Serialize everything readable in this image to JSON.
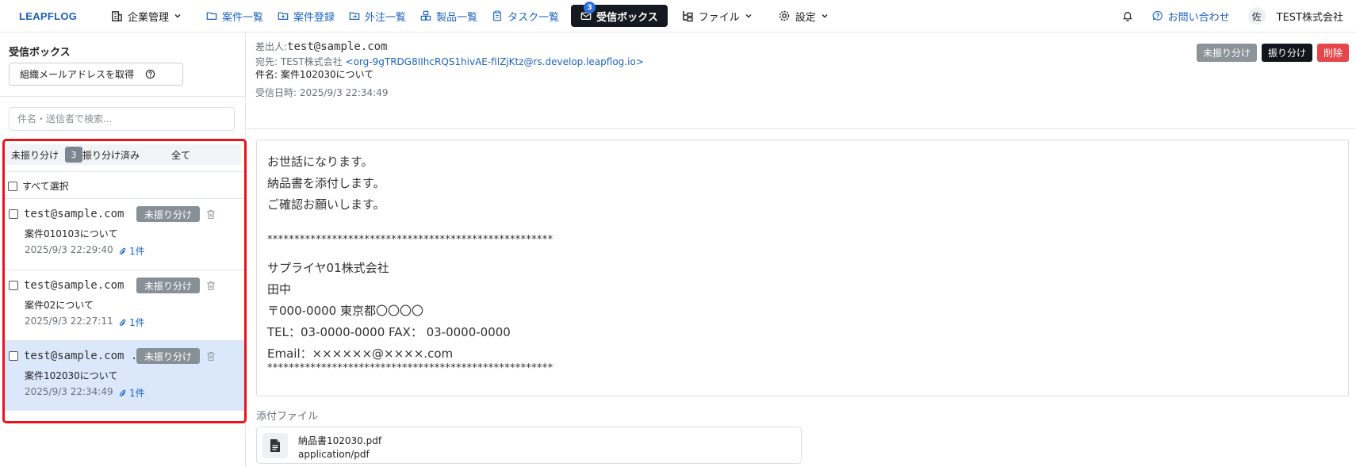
{
  "nav": {
    "logo": "LEAPFLOG",
    "items": [
      {
        "label": "企業管理",
        "icon": "building-icon",
        "style": "dark",
        "caret": true
      },
      {
        "label": "案件一覧",
        "icon": "folder-icon",
        "style": "blue"
      },
      {
        "label": "案件登録",
        "icon": "folder-plus-icon",
        "style": "blue"
      },
      {
        "label": "外注一覧",
        "icon": "folder-out-icon",
        "style": "blue"
      },
      {
        "label": "製品一覧",
        "icon": "boxes-icon",
        "style": "blue"
      },
      {
        "label": "タスク一覧",
        "icon": "clipboard-icon",
        "style": "blue"
      }
    ],
    "inbox": {
      "label": "受信ボックス",
      "badge": "3",
      "icon": "mail-icon"
    },
    "files": {
      "label": "ファイル",
      "icon": "file-tree-icon"
    },
    "settings": {
      "label": "設定",
      "icon": "gear-icon"
    },
    "contact": {
      "label": "お問い合わせ",
      "icon": "help-chat-icon"
    },
    "avatar": "佐",
    "company": "TEST株式会社"
  },
  "sidebar": {
    "title": "受信ボックス",
    "org_button": "組織メールアドレスを取得",
    "search_placeholder": "件名・送信者で検索...",
    "tabs": {
      "unassigned": "未振り分け",
      "count": "3",
      "assigned": "振り分け済み",
      "all": "全て"
    },
    "select_all": "すべて選択",
    "mails": [
      {
        "from": "test@sample.com",
        "badge": "未振り分け",
        "subject": "案件010103について",
        "date": "2025/9/3 22:29:40",
        "attach": "1件",
        "selected": false
      },
      {
        "from": "test@sample.com",
        "badge": "未振り分け",
        "subject": "案件02について",
        "date": "2025/9/3 22:27:11",
        "attach": "1件",
        "selected": false
      },
      {
        "from": "test@sample.com .",
        "badge": "未振り分け",
        "subject": "案件102030について",
        "date": "2025/9/3 22:34:49",
        "attach": "1件",
        "selected": true
      }
    ]
  },
  "detail": {
    "from_label": "差出人:",
    "from": "test@sample.com",
    "to_label": "宛先: TEST株式会社 ",
    "to_addr": "<org-9gTRDG8IIhcRQS1hivAE-filZjKtz@rs.develop.leapflog.io>",
    "subject_label": "件名: ",
    "subject": "案件102030について",
    "received": "受信日時: 2025/9/3 22:34:49",
    "actions": {
      "unassigned": "未振り分け",
      "assign": "振り分け",
      "delete": "削除"
    },
    "body": [
      "お世話になります。",
      "納品書を添付します。",
      "ご確認お願いします。",
      "",
      "*****************************************************",
      "サプライヤ01株式会社",
      "田中",
      "〒000-0000 東京都〇〇〇〇",
      "TEL：03-0000-0000 FAX： 03-0000-0000",
      "Email：××××××@××××.com",
      "*****************************************************"
    ],
    "attachments_label": "添付ファイル",
    "attachment": {
      "name": "納品書102030.pdf",
      "type": "application/pdf",
      "icon": "document-icon"
    }
  },
  "colors": {
    "accent": "#1d63c2",
    "badge": "#878f97",
    "danger": "#e6454a",
    "highlight": "#e8141b",
    "selected_row": "#dbe8fb"
  }
}
